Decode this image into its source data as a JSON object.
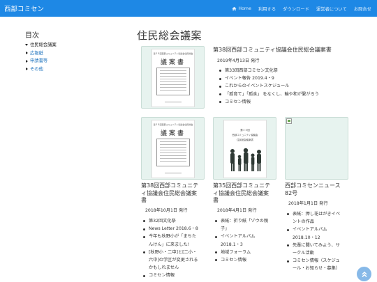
{
  "header": {
    "brand": "西部コミセン",
    "nav": [
      {
        "label": "Home",
        "icon": "home-icon"
      },
      {
        "label": "利用する"
      },
      {
        "label": "ダウンロード"
      },
      {
        "label": "運営者について"
      },
      {
        "label": "お問合せ"
      }
    ]
  },
  "sidebar": {
    "title": "目次",
    "items": [
      {
        "label": "住民総会議案",
        "current": true
      },
      {
        "label": "広報紙"
      },
      {
        "label": "申請書等"
      },
      {
        "label": "その他"
      }
    ]
  },
  "page_title": "住民総会議案",
  "thumbs": {
    "doc_caption": "第３８回西部コミュニティ協議会住民総会",
    "doc_title": "議案書",
    "doc_title_2": "議案書",
    "pamph_line1": "第３５回",
    "pamph_line2": "西部コミュニティ協議会",
    "pamph_line3": "住民総会議案書"
  },
  "entries": [
    {
      "title": "第38回西部コミュニティ協議会住民総会議案書",
      "date": "2019年4月13日  発行",
      "items": [
        "第33回西部コミセン文化祭",
        "イベント報告 2019.4・9",
        "これからのイベントスケジュール",
        "「孤育て」「孤食」 をなくし、輪や和が繋がろう",
        "コミセン情報"
      ]
    },
    {
      "title_lines": [
        "第38回西部コミュニテ",
        "ィ協議会住民総会議案",
        "書"
      ],
      "date": "2018年10月1日  発行",
      "items": [
        "第32回文化祭",
        "News Letter 2018.6・8",
        "今年も秋野小が「まちた",
        "んけん」に来ました!",
        "[秋野小・二中]と[二小・",
        "六中]の学区が変更される",
        "かもしれません",
        "コミセン情報"
      ]
    },
    {
      "title_lines": [
        "第35回西部コミュニテ",
        "ィ協議会住民総会議案",
        "書"
      ],
      "date": "2018年4月1日  発行",
      "items": [
        "表紙：折り紙「ゾウの親",
        "子」",
        "イベントアルバム",
        "2018.1・3",
        "地域フォーラム",
        "コミセン情報"
      ]
    },
    {
      "title_lines": [
        "西部コミセンニュース",
        "82号"
      ],
      "date": "2018年1月1日  発行",
      "items": [
        "表紙：押し花はがきイベ",
        "ントの作品",
        "イベントアルバム",
        "2018.10・12",
        "先輩に聞いてみよう、サ",
        "ークル活動",
        "コミセン情報（スケジュ",
        "ール・お知らせ・募集）"
      ]
    }
  ],
  "colors": {
    "navbar": "#1e88e5",
    "link": "#1e73be",
    "thumb_bg": "#e7f3ef",
    "scroll_top": "#87b9e8"
  }
}
